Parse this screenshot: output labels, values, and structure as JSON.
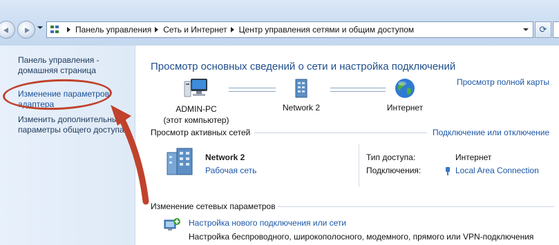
{
  "address_bar": {
    "breadcrumbs": [
      "Панель управления",
      "Сеть и Интернет",
      "Центр управления сетями и общим доступом"
    ]
  },
  "left_pane": {
    "home": "Панель управления - домашняя страница",
    "adapter": "Изменение параметров адаптера",
    "sharing": "Изменить дополнительные параметры общего доступа"
  },
  "main": {
    "title": "Просмотр основных сведений о сети и настройка подключений",
    "full_map_link": "Просмотр полной карты",
    "map": {
      "computer_name": "ADMIN-PC",
      "computer_caption": "(этот компьютер)",
      "network_name": "Network  2",
      "internet_label": "Интернет"
    },
    "active_networks": {
      "header": "Просмотр активных сетей",
      "connect_link": "Подключение или отключение",
      "network_name": "Network  2",
      "network_type": "Рабочая сеть",
      "access_type_label": "Тип доступа:",
      "access_type_value": "Интернет",
      "connections_label": "Подключения:",
      "connections_value": "Local Area Connection"
    },
    "change_settings": {
      "header": "Изменение сетевых параметров",
      "task_link": "Настройка нового подключения или сети",
      "task_desc": "Настройка беспроводного, широкополосного, модемного, прямого или VPN-подключения"
    }
  },
  "colors": {
    "link": "#1a56a6",
    "title": "#1f4e8c",
    "highlight": "#c0422c"
  },
  "icons": {
    "back": "back-arrow-icon",
    "forward": "forward-arrow-icon",
    "refresh": "refresh-icon",
    "computer": "computer-icon",
    "network": "network-building-icon",
    "internet": "globe-icon",
    "plug": "network-plug-icon",
    "new_connection": "new-connection-icon"
  }
}
